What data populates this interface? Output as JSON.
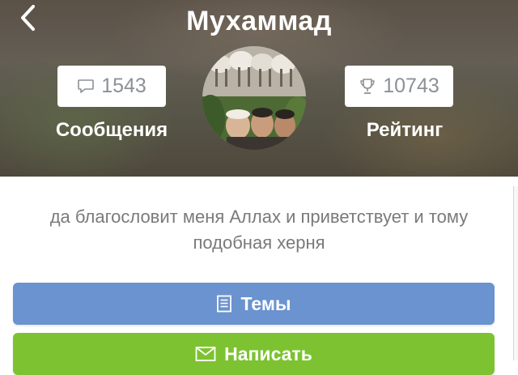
{
  "header": {
    "title": "Мухаммад",
    "messages": {
      "count": "1543",
      "label": "Сообщения",
      "icon": "speech-bubble-icon"
    },
    "rating": {
      "count": "10743",
      "label": "Рейтинг",
      "icon": "trophy-icon"
    },
    "back_icon": "chevron-left-icon"
  },
  "profile": {
    "bio": "да благословит меня Аллах и приветствует и тому подобная херня"
  },
  "actions": {
    "topics_label": "Темы",
    "topics_icon": "document-list-icon",
    "write_label": "Написать",
    "write_icon": "envelope-icon"
  },
  "colors": {
    "topics_button": "#6a93cf",
    "write_button": "#7dc331",
    "stat_text": "#8c9196",
    "bio_text": "#7a7a7a"
  }
}
